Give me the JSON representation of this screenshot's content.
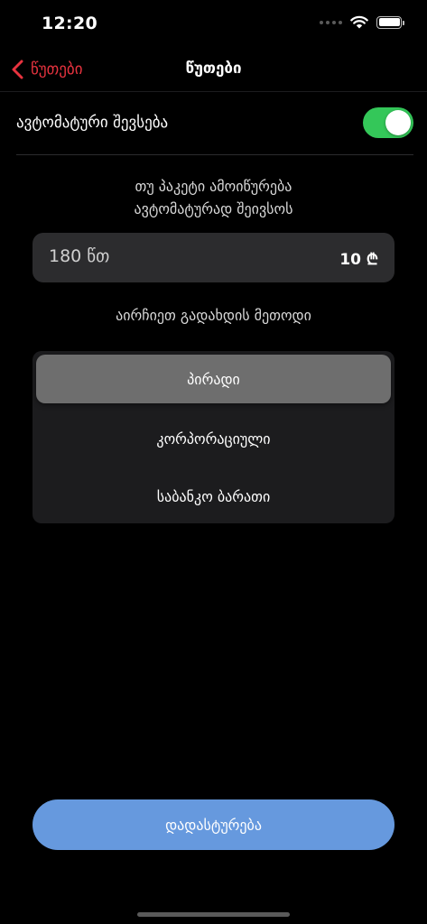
{
  "status_bar": {
    "time": "12:20"
  },
  "nav": {
    "back_label": "წუთები",
    "title": "წუთები"
  },
  "auto_refill": {
    "label": "ავტომატური შევსება",
    "enabled": true
  },
  "hint": {
    "line1": "თუ პაკეტი ამოიწურება",
    "line2": "ავტომატურად შეივსოს"
  },
  "package": {
    "minutes": "180 წთ",
    "price": "10 ₾"
  },
  "payment": {
    "title": "აირჩიეთ გადახდის მეთოდი",
    "options": [
      {
        "label": "პირადი",
        "selected": true
      },
      {
        "label": "კორპორაციული",
        "selected": false
      },
      {
        "label": "საბანკო ბარათი",
        "selected": false
      }
    ]
  },
  "confirm": {
    "label": "დადასტურება"
  },
  "colors": {
    "accent": "#e8333f",
    "toggle_on": "#34c759",
    "button": "#6699de"
  }
}
